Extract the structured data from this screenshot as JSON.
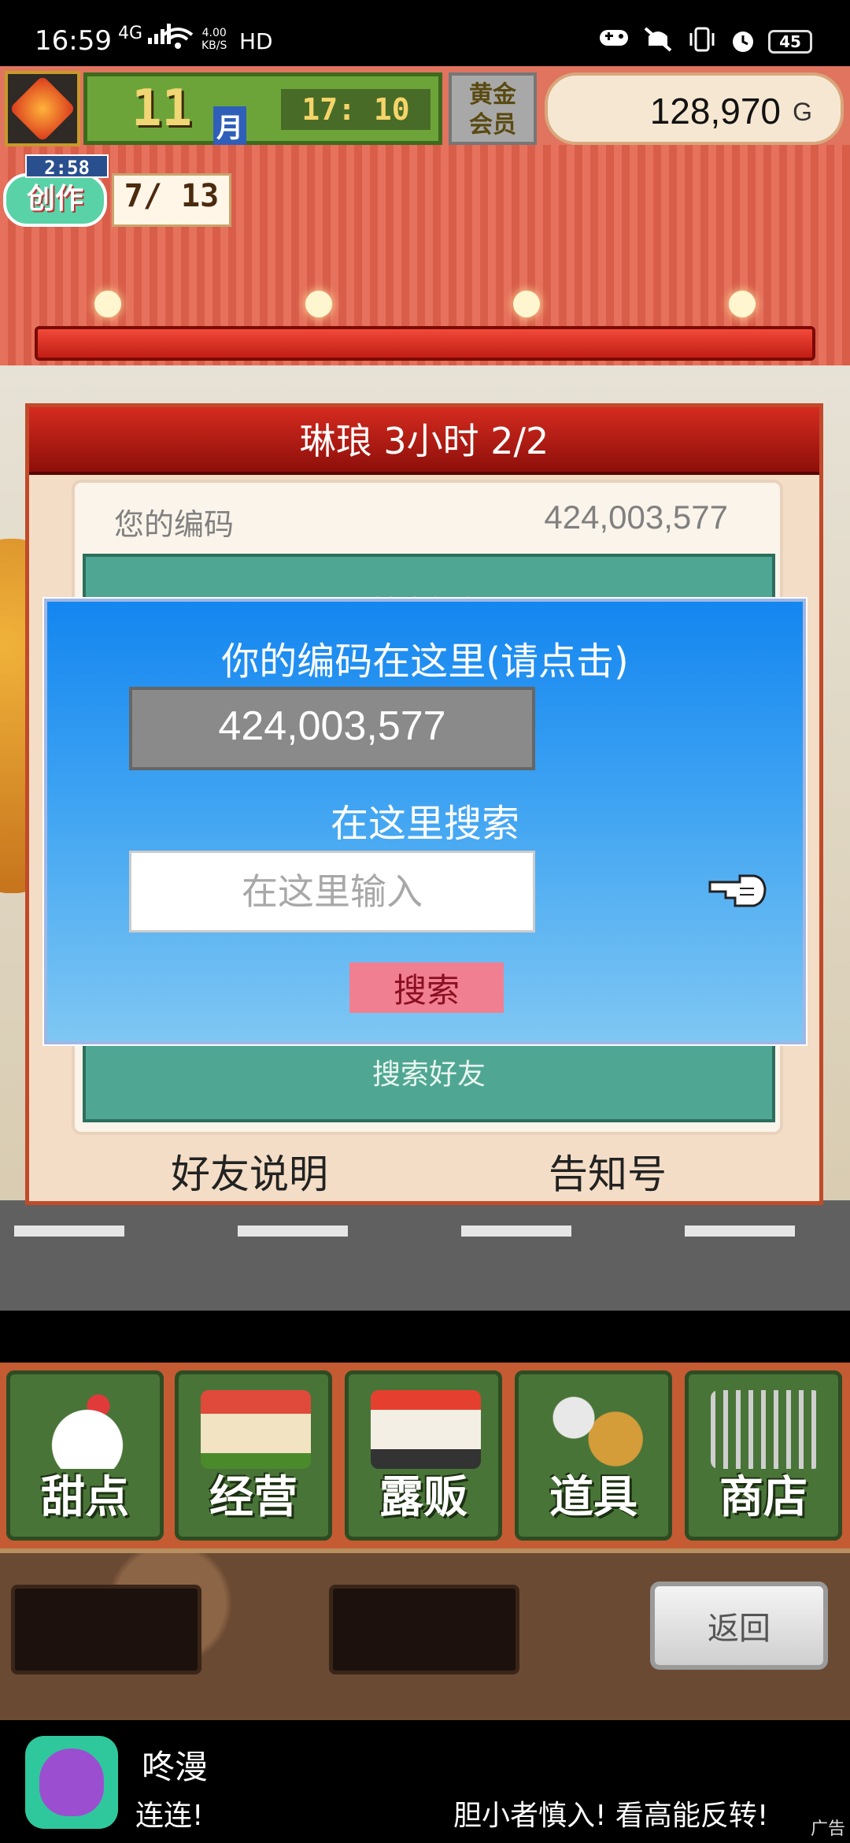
{
  "status_bar": {
    "time": "16:59",
    "network": "4G",
    "speed": "4.00\nKB/S",
    "hd": "HD",
    "battery": "45"
  },
  "hud": {
    "month_number": "11",
    "month_label": "月",
    "clock": "17: 10",
    "gold_member": "黄金\n会员",
    "money": "128,970",
    "money_unit": "G",
    "create_timer": "2:58",
    "create_label": "创作",
    "create_count": "7/ 13"
  },
  "friend_panel": {
    "title": "琳琅  3小时 2/2",
    "my_code_label": "您的编码",
    "my_code_value": "424,003,577",
    "teal_top_text": "搜索好友",
    "teal_bottom_text": "搜索好友",
    "help_link": "好友说明",
    "notice_link": "告知号"
  },
  "search_dialog": {
    "code_title": "你的编码在这里(请点击)",
    "code_value": "424,003,577",
    "search_title": "在这里搜索",
    "search_placeholder": "在这里输入",
    "search_button": "搜索"
  },
  "menu": {
    "items": [
      {
        "label": "甜点",
        "icon": "cake-icon"
      },
      {
        "label": "经营",
        "icon": "shop-icon"
      },
      {
        "label": "露贩",
        "icon": "food-truck-icon"
      },
      {
        "label": "道具",
        "icon": "items-bag-icon"
      },
      {
        "label": "商店",
        "icon": "shopping-cart-icon"
      }
    ],
    "back_button": "返回"
  },
  "ad": {
    "title": "咚漫",
    "desc_left": "连连!",
    "desc_right": "胆小者慎入! 看高能反转!",
    "tag": "广告"
  },
  "colors": {
    "panel_title_red": "#b31a12",
    "dialog_blue": "#1486f0",
    "menu_green": "#497438",
    "search_button_pink": "#f07f91"
  }
}
